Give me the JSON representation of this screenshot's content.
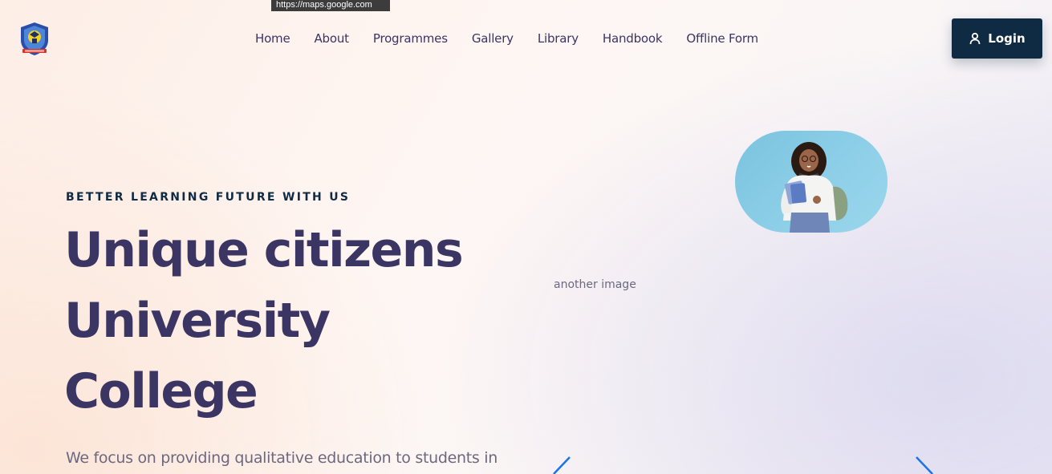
{
  "tooltip": {
    "url": "https://maps.google.com"
  },
  "header": {
    "logo_icon": "college-crest-logo",
    "nav": [
      {
        "label": "Home"
      },
      {
        "label": "About"
      },
      {
        "label": "Programmes"
      },
      {
        "label": "Gallery"
      },
      {
        "label": "Library"
      },
      {
        "label": "Handbook"
      },
      {
        "label": "Offline Form"
      }
    ],
    "login": {
      "label": "Login",
      "icon": "user-icon"
    }
  },
  "hero": {
    "eyebrow": "BETTER LEARNING FUTURE WITH US",
    "title_lines": [
      "Unique citizens",
      "University",
      "College"
    ],
    "lead": "We focus on providing qualitative education to students in",
    "image_alt": "another image",
    "photo_icon": "student-photo"
  },
  "carousel": {
    "prev_icon": "chevron-left-icon",
    "next_icon": "chevron-right-icon"
  },
  "colors": {
    "primary_dark": "#0f2a43",
    "heading": "#3b3564",
    "body_text": "#6b6880",
    "accent_blue": "#1a73e8",
    "photo_bg": "#87cbe6"
  }
}
